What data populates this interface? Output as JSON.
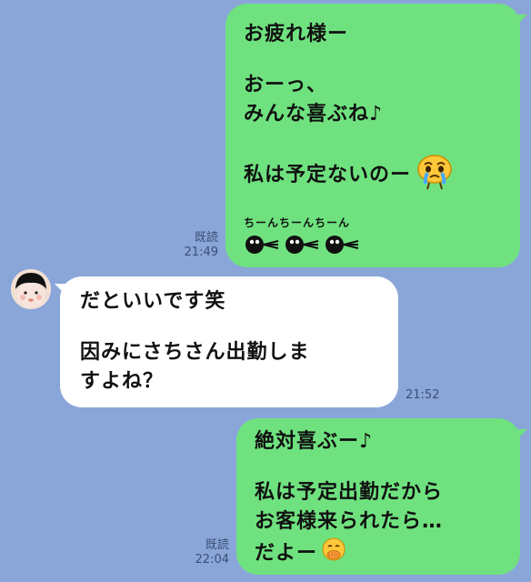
{
  "messages": [
    {
      "direction": "outgoing",
      "read_label": "既読",
      "time": "21:49",
      "lines": [
        "お疲れ様ー",
        "",
        "おーっ、",
        "みんな喜ぶね♪",
        "",
        "私は予定ないのー"
      ],
      "sticker_text": "ちーんちーんちーん",
      "emoji": "crying-face"
    },
    {
      "direction": "incoming",
      "time": "21:52",
      "lines": [
        "だといいです笑",
        "",
        "因みにさちさん出勤しま",
        "すよね？"
      ]
    },
    {
      "direction": "outgoing",
      "read_label": "既読",
      "time": "22:04",
      "lines": [
        "絶対喜ぶー♪",
        "",
        "私は予定出勤だから",
        "お客様来られたら…",
        "だよー"
      ],
      "emoji": "hand-over-mouth-face"
    }
  ],
  "colors": {
    "background": "#8aa6d8",
    "outgoing_bubble": "#6fe27f",
    "incoming_bubble": "#ffffff",
    "meta_text": "#3b4f76"
  }
}
